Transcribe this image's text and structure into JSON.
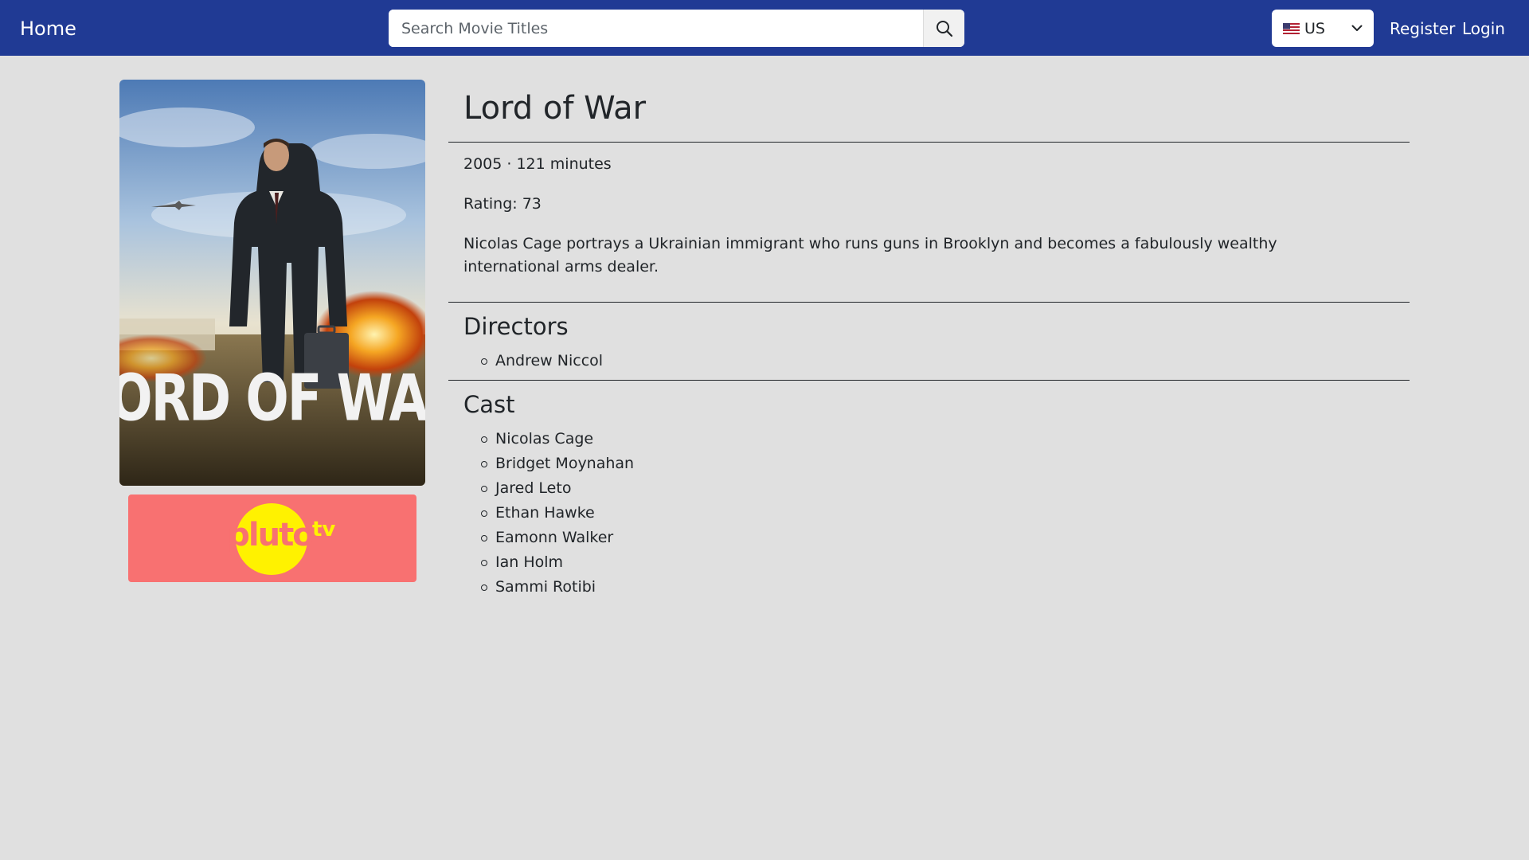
{
  "navbar": {
    "home_label": "Home",
    "search_placeholder": "Search Movie Titles",
    "search_value": "",
    "country": "US",
    "register_label": "Register",
    "login_label": "Login"
  },
  "movie": {
    "title": "Lord of War",
    "year_runtime": "2005 · 121 minutes",
    "rating": "Rating: 73",
    "overview": "Nicolas Cage portrays a Ukrainian immigrant who runs guns in Brooklyn and becomes a fabulously wealthy international arms dealer.",
    "poster_text": "LORD OF WAR"
  },
  "provider": {
    "logo_text_main": "pluto",
    "logo_text_sup": "tv"
  },
  "directors": {
    "heading": "Directors",
    "names": [
      "Andrew Niccol"
    ]
  },
  "cast": {
    "heading": "Cast",
    "names": [
      "Nicolas Cage",
      "Bridget Moynahan",
      "Jared Leto",
      "Ethan Hawke",
      "Eamonn Walker",
      "Ian Holm",
      "Sammi Rotibi"
    ]
  },
  "colors": {
    "navbar": "#203a94",
    "page_background": "#e0e0e0",
    "provider_tile": "#f87171",
    "pluto_logo": "#fff200"
  },
  "icons": {
    "search": "search-icon",
    "flag": "us-flag-icon",
    "chevron": "chevron-down-icon"
  }
}
